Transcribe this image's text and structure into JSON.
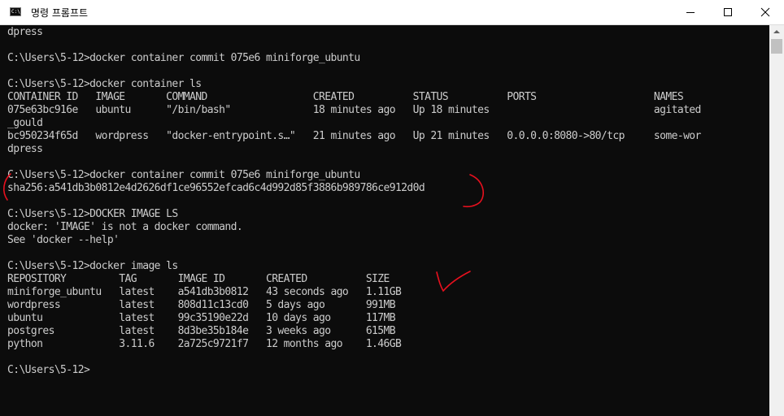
{
  "window": {
    "title": "명령 프롬프트",
    "icon_text": "C:\\"
  },
  "terminal": {
    "lines": [
      "dpress",
      "",
      "C:\\Users\\5-12>docker container commit 075e6 miniforge_ubuntu",
      "",
      "C:\\Users\\5-12>docker container ls",
      "CONTAINER ID   IMAGE       COMMAND                  CREATED          STATUS          PORTS                    NAMES",
      "075e63bc916e   ubuntu      \"/bin/bash\"              18 minutes ago   Up 18 minutes                            agitated",
      "_gould",
      "bc950234f65d   wordpress   \"docker-entrypoint.s…\"   21 minutes ago   Up 21 minutes   0.0.0.0:8080->80/tcp     some-wor",
      "dpress",
      "",
      "C:\\Users\\5-12>docker container commit 075e6 miniforge_ubuntu",
      "sha256:a541db3b0812e4d2626df1ce96552efcad6c4d992d85f3886b989786ce912d0d",
      "",
      "C:\\Users\\5-12>DOCKER IMAGE LS",
      "docker: 'IMAGE' is not a docker command.",
      "See 'docker --help'",
      "",
      "C:\\Users\\5-12>docker image ls",
      "REPOSITORY         TAG       IMAGE ID       CREATED          SIZE",
      "miniforge_ubuntu   latest    a541db3b0812   43 seconds ago   1.11GB",
      "wordpress          latest    808d11c13cd0   5 days ago       991MB",
      "ubuntu             latest    99c35190e22d   10 days ago      117MB",
      "postgres           latest    8d3be35b184e   3 weeks ago      615MB",
      "python             3.11.6    2a725c9721f7   12 months ago    1.46GB",
      "",
      "C:\\Users\\5-12>"
    ]
  },
  "colors": {
    "terminal_bg": "#0c0c0c",
    "terminal_fg": "#cccccc",
    "annotation_red": "#e8101e"
  }
}
